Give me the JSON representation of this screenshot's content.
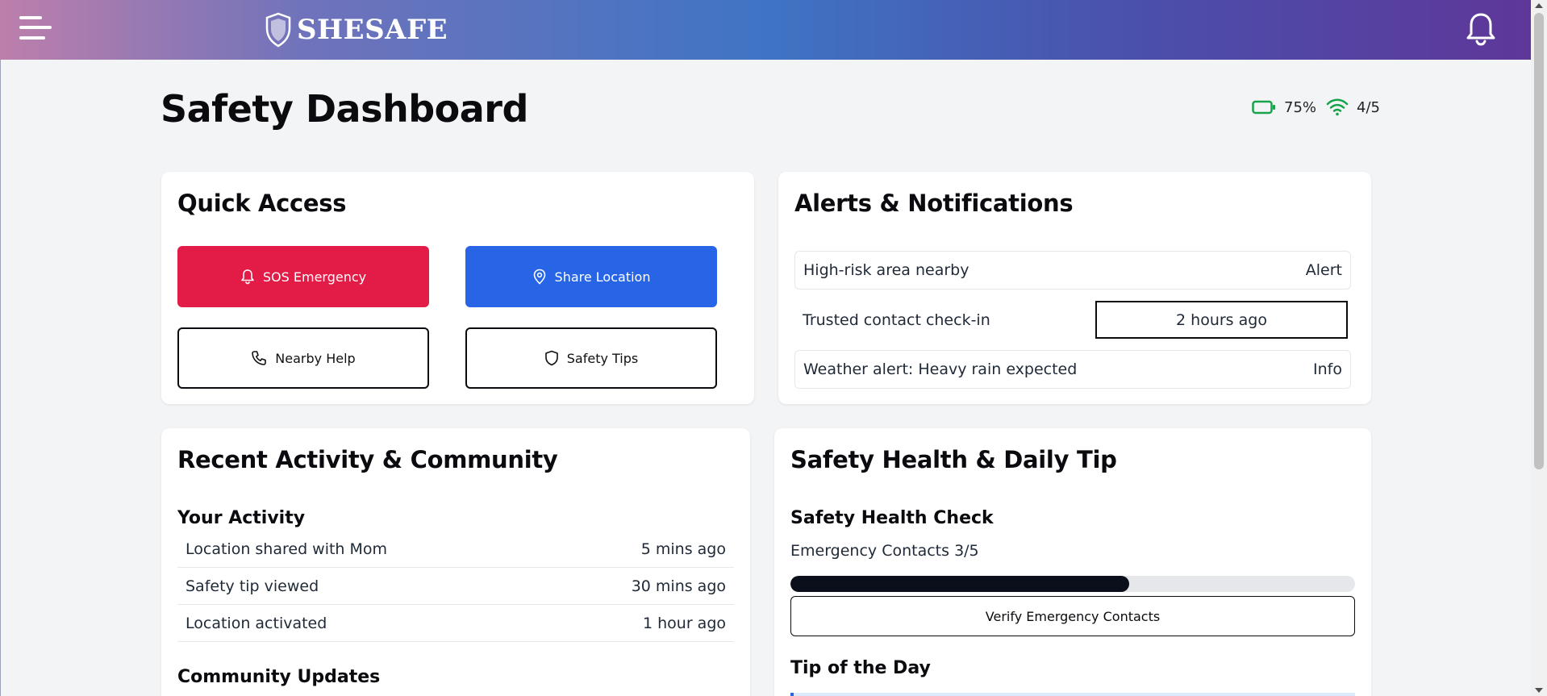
{
  "header": {
    "brand": "SheSafe",
    "menu_icon": "hamburger-menu-icon",
    "notification_icon": "bell-icon",
    "gradient": [
      "#bd7fab",
      "#3f74c4",
      "#5e3799"
    ]
  },
  "page": {
    "title": "Safety Dashboard"
  },
  "status": {
    "battery": "75%",
    "signal": "4/5",
    "color": "#16a34a"
  },
  "quick_access": {
    "title": "Quick Access",
    "buttons": [
      {
        "label": "SOS Emergency",
        "icon": "bell-icon",
        "color": "#e31b47"
      },
      {
        "label": "Share Location",
        "icon": "map-pin-icon",
        "color": "#2764e6"
      },
      {
        "label": "Nearby Help",
        "icon": "phone-icon"
      },
      {
        "label": "Safety Tips",
        "icon": "shield-icon"
      }
    ]
  },
  "alerts": {
    "title": "Alerts & Notifications",
    "items": [
      {
        "text": "High-risk area nearby",
        "tag": "Alert"
      },
      {
        "text": "Trusted contact check-in",
        "tag": "2 hours ago"
      },
      {
        "text": "Weather alert: Heavy rain expected",
        "tag": "Info"
      }
    ]
  },
  "activity": {
    "title": "Recent Activity & Community",
    "your_activity": "Your Activity",
    "items": [
      {
        "text": "Location shared with Mom",
        "time": "5 mins ago"
      },
      {
        "text": "Safety tip viewed",
        "time": "30 mins ago"
      },
      {
        "text": "Location activated",
        "time": "1 hour ago"
      }
    ],
    "community": "Community Updates"
  },
  "health": {
    "title": "Safety Health & Daily Tip",
    "check_title": "Safety Health Check",
    "contacts_label": "Emergency Contacts 3/5",
    "contacts_progress": 0.6,
    "verify_button": "Verify Emergency Contacts",
    "tip_title": "Tip of the Day"
  }
}
